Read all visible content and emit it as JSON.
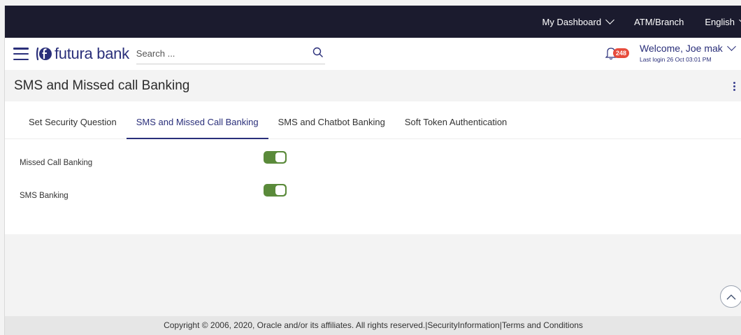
{
  "topbar": {
    "dashboard": "My Dashboard",
    "atm_branch": "ATM/Branch",
    "language": "English"
  },
  "header": {
    "brand": "futura bank",
    "search_placeholder": "Search ...",
    "notification_count": "248",
    "welcome": "Welcome, Joe mak",
    "last_login": "Last login 26 Oct 03:01 PM"
  },
  "page": {
    "title": "SMS and Missed call Banking"
  },
  "tabs": [
    {
      "label": "Set Security Question",
      "active": false
    },
    {
      "label": "SMS and Missed Call Banking",
      "active": true
    },
    {
      "label": "SMS and Chatbot Banking",
      "active": false
    },
    {
      "label": "Soft Token Authentication",
      "active": false
    }
  ],
  "settings": [
    {
      "label": "Missed Call Banking",
      "enabled": true
    },
    {
      "label": "SMS Banking",
      "enabled": true
    }
  ],
  "footer": {
    "copyright": "Copyright © 2006, 2020, Oracle and/or its affiliates. All rights reserved.",
    "separator": "|",
    "security_link": "SecurityInformation",
    "terms_link": "Terms and Conditions"
  },
  "colors": {
    "brand": "#2a2f7a",
    "topbar": "#1b1b2e",
    "toggle_on": "#5a8a3a",
    "badge": "#e74c3c"
  },
  "icons": {
    "menu": "hamburger-icon",
    "search": "search-icon",
    "notification": "bell-icon",
    "more": "kebab-icon",
    "scroll_top": "chevron-up-icon"
  }
}
